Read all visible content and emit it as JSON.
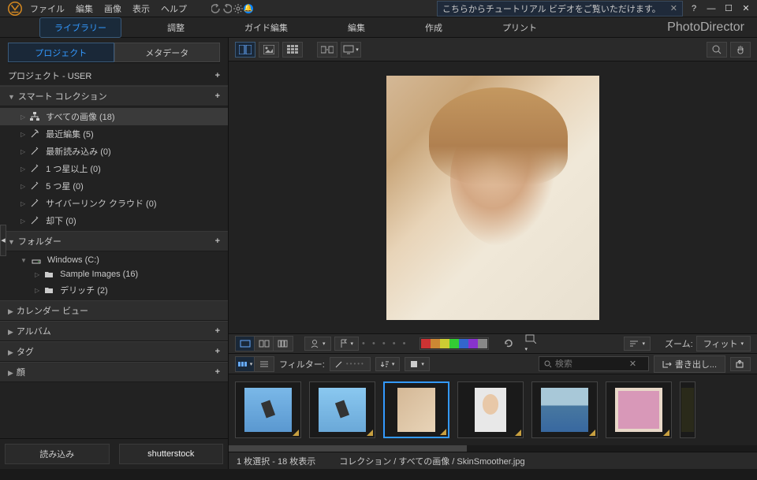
{
  "menus": {
    "file": "ファイル",
    "edit": "編集",
    "image": "画像",
    "view": "表示",
    "help": "ヘルプ"
  },
  "tutorial_banner": "こちらからチュートリアル ビデオをご覧いただけます。",
  "modules": {
    "library": "ライブラリー",
    "adjust": "調整",
    "guided": "ガイド編集",
    "edit": "編集",
    "create": "作成",
    "print": "プリント"
  },
  "brand": "PhotoDirector",
  "side_tabs": {
    "project": "プロジェクト",
    "metadata": "メタデータ"
  },
  "project_header": "プロジェクト - USER",
  "sections": {
    "smart": "スマート コレクション",
    "folder": "フォルダー",
    "calendar": "カレンダー ビュー",
    "album": "アルバム",
    "tag": "タグ",
    "face": "顔"
  },
  "smart_items": [
    {
      "label": "すべての画像 (18)"
    },
    {
      "label": "最近編集 (5)"
    },
    {
      "label": "最新読み込み (0)"
    },
    {
      "label": "1 つ星以上 (0)"
    },
    {
      "label": "5 つ星 (0)"
    },
    {
      "label": "サイバーリンク クラウド (0)"
    },
    {
      "label": "却下 (0)"
    }
  ],
  "folder_items": [
    {
      "label": "Windows (C:)"
    },
    {
      "label": "Sample Images (16)"
    },
    {
      "label": "デリッチ (2)"
    }
  ],
  "side_buttons": {
    "import": "読み込み",
    "stock": "shutterstock"
  },
  "swatch_colors": [
    "#cc3333",
    "#cc8833",
    "#cccc33",
    "#33cc33",
    "#3366cc",
    "#8833cc",
    "#888888"
  ],
  "zoom_label": "ズーム:",
  "zoom_value": "フィット",
  "filter_label": "フィルター:",
  "search_placeholder": "検索",
  "export_btn": "書き出し...",
  "status": {
    "selection": "1 枚選択 - 18 枚表示",
    "path": "コレクション  / すべての画像  /  SkinSmoother.jpg"
  }
}
